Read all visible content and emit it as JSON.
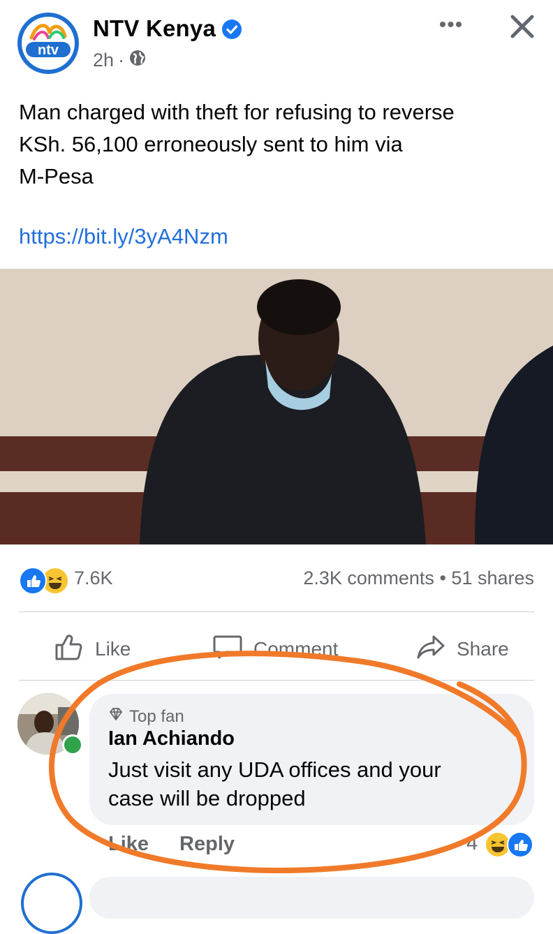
{
  "post": {
    "page_name": "NTV Kenya",
    "time": "2h",
    "separator": "·",
    "more_label": "•••",
    "text_line1": "Man charged with theft for refusing to reverse",
    "text_line2": "KSh. 56,100 erroneously sent to him via",
    "text_line3": "M-Pesa",
    "link": "https://bit.ly/3yA4Nzm",
    "logo_text": "ntv"
  },
  "reactions": {
    "count": "7.6K",
    "comments": "2.3K comments",
    "dot": "•",
    "shares": "51 shares"
  },
  "actions": {
    "like": "Like",
    "comment": "Comment",
    "share": "Share"
  },
  "comment": {
    "badge": "Top fan",
    "author": "Ian Achiando",
    "line1": "Just visit any UDA offices and your",
    "line2": "case will be dropped",
    "like": "Like",
    "reply": "Reply",
    "reaction_count": "4"
  },
  "colors": {
    "brand_blue": "#1877f2",
    "link_blue": "#216fdb",
    "annotation_orange": "#f07a2a",
    "online_green": "#31a24c"
  }
}
